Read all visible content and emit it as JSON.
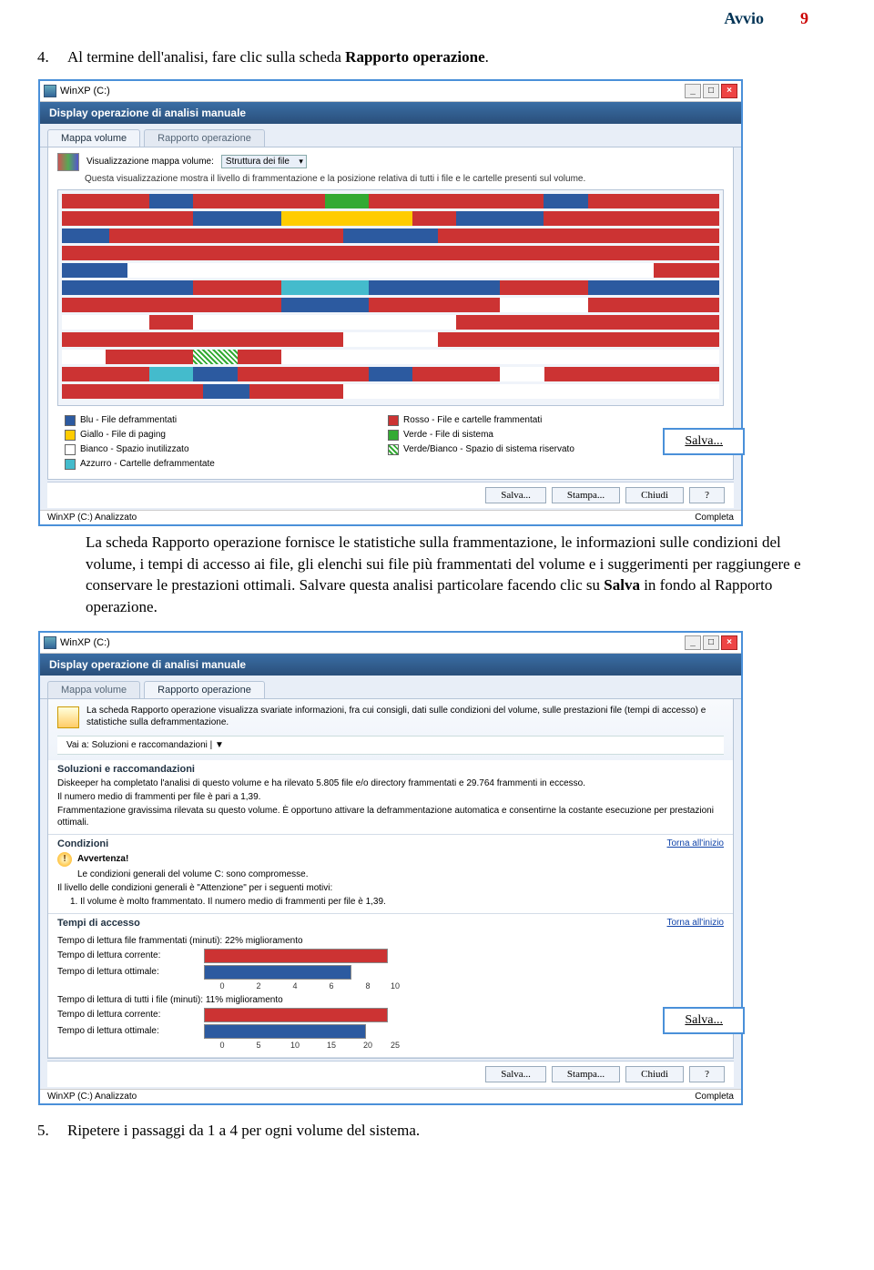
{
  "page": {
    "title": "Avvio",
    "number": "9"
  },
  "step4": {
    "num": "4.",
    "text_a": "Al termine dell'analisi, fare clic sulla scheda ",
    "bold": "Rapporto operazione",
    "text_b": "."
  },
  "win1": {
    "title": "WinXP (C:)",
    "subtitle": "Display operazione di analisi manuale",
    "tab_active": "Mappa volume",
    "tab_inactive": "Rapporto operazione",
    "viz_label": "Visualizzazione mappa volume:",
    "viz_combo": "Struttura dei file",
    "viz_desc": "Questa visualizzazione mostra il livello di frammentazione e la posizione relativa di tutti i file e le cartelle presenti sul volume.",
    "legend": {
      "blue": "Blu - File deframmentati",
      "red": "Rosso - File e cartelle frammentati",
      "yellow": "Giallo - File di paging",
      "green": "Verde - File di sistema",
      "white": "Bianco - Spazio inutilizzato",
      "hatch": "Verde/Bianco - Spazio di sistema riservato",
      "cyan": "Azzurro - Cartelle deframmentate"
    },
    "callout": "Salva...",
    "btn_save": "Salva...",
    "btn_print": "Stampa...",
    "btn_close": "Chiudi",
    "btn_help": "?",
    "status_left": "WinXP (C:) Analizzato",
    "status_right": "Completa"
  },
  "para2": {
    "a": "La scheda Rapporto operazione fornisce le statistiche sulla frammentazione, le informazioni sulle condizioni del volume, i tempi di accesso ai file, gli elenchi sui file più frammentati del volume e i suggerimenti per raggiungere e conservare le prestazioni ottimali. Salvare questa analisi particolare facendo clic su ",
    "bold": "Salva",
    "b": " in fondo al Rapporto operazione."
  },
  "win2": {
    "title": "WinXP (C:)",
    "subtitle": "Display operazione di analisi manuale",
    "tab_inactive": "Mappa volume",
    "tab_active": "Rapporto operazione",
    "intro": "La scheda Rapporto operazione visualizza svariate informazioni, fra cui consigli, dati sulle condizioni del volume, sulle prestazioni file (tempi di accesso) e statistiche sulla deframmentazione.",
    "goto": "Vai a: Soluzioni e raccomandazioni | ▼",
    "sec_sol_title": "Soluzioni e raccomandazioni",
    "sec_sol_p1": "Diskeeper ha completato l'analisi di questo volume e ha rilevato 5.805 file e/o directory frammentati e 29.764 frammenti in eccesso.",
    "sec_sol_p2": "Il numero medio di frammenti per file è pari a 1,39.",
    "sec_sol_p3": "Frammentazione gravissima rilevata su questo volume. È opportuno attivare la deframmentazione automatica e consentirne la costante esecuzione per prestazioni ottimali.",
    "sec_cond_title": "Condizioni",
    "back_link": "Torna all'inizio",
    "warn_label": "Avvertenza!",
    "warn_text": "Le condizioni generali del volume C: sono compromesse.",
    "warn_text2": "Il livello delle condizioni generali è \"Attenzione\" per i seguenti motivi:",
    "warn_text3": "1. Il volume è molto frammentato. Il numero medio di frammenti per file è 1,39.",
    "sec_tempi_title": "Tempi di accesso",
    "chart1_title": "Tempo di lettura file frammentati (minuti): 22% miglioramento",
    "chart1_label_cur": "Tempo di lettura corrente:",
    "chart1_label_opt": "Tempo di lettura ottimale:",
    "chart2_title": "Tempo di lettura di tutti i file (minuti): 11% miglioramento",
    "chart2_label_cur": "Tempo di lettura corrente:",
    "chart2_label_opt": "Tempo di lettura ottimale:",
    "callout": "Salva...",
    "btn_save": "Salva...",
    "btn_print": "Stampa...",
    "btn_close": "Chiudi",
    "btn_help": "?",
    "status_left": "WinXP (C:) Analizzato",
    "status_right": "Completa"
  },
  "chart_data": [
    {
      "type": "bar",
      "title": "Tempo di lettura file frammentati (minuti): 22% miglioramento",
      "categories": [
        "Tempo di lettura corrente",
        "Tempo di lettura ottimale"
      ],
      "values": [
        10,
        8
      ],
      "xlim": [
        0,
        10
      ],
      "ticks": [
        0,
        2,
        4,
        6,
        8,
        10
      ],
      "colors": [
        "#c33",
        "#2c5aa0"
      ]
    },
    {
      "type": "bar",
      "title": "Tempo di lettura di tutti i file (minuti): 11% miglioramento",
      "categories": [
        "Tempo di lettura corrente",
        "Tempo di lettura ottimale"
      ],
      "values": [
        25,
        22
      ],
      "xlim": [
        0,
        25
      ],
      "ticks": [
        0,
        5,
        10,
        15,
        20,
        25
      ],
      "colors": [
        "#c33",
        "#2c5aa0"
      ]
    }
  ],
  "step5": {
    "num": "5.",
    "text": "Ripetere i passaggi da 1 a 4 per ogni volume del sistema."
  }
}
